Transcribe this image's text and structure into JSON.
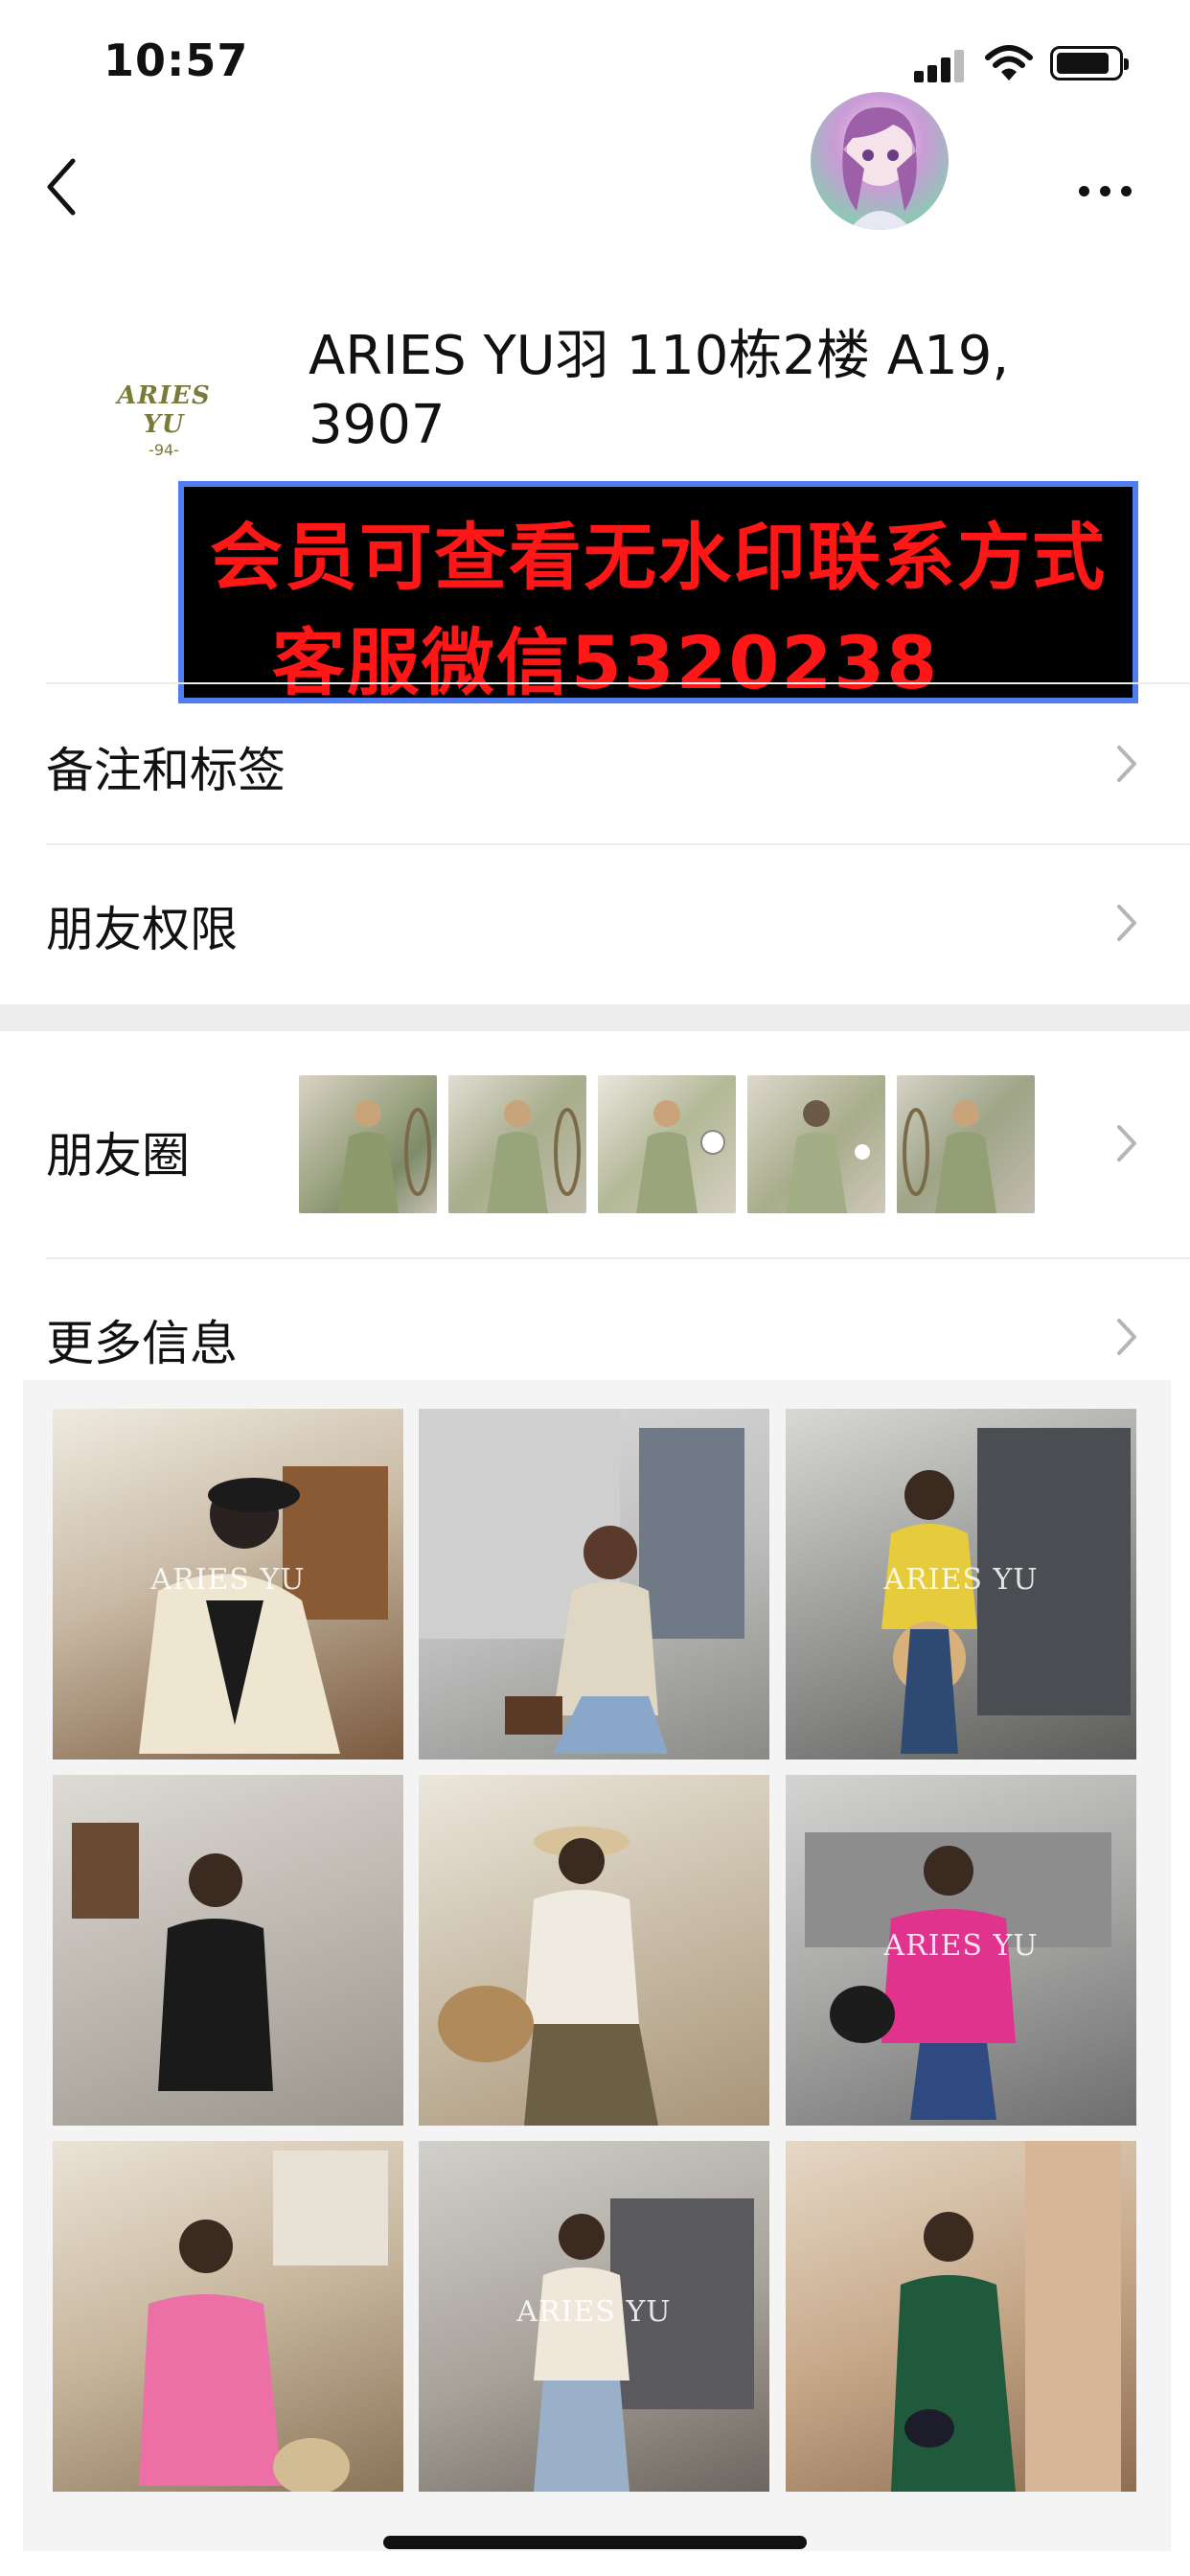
{
  "status_bar": {
    "time": "10:57"
  },
  "nav": {
    "back_icon": "chevron-left-icon",
    "more_icon": "ellipsis-icon"
  },
  "profile": {
    "logo_text": "ARIES YU",
    "logo_sub": "-94-",
    "name_line1": "ARIES YU羽 110栋2楼 A19,",
    "name_line2": "3907"
  },
  "banner": {
    "line1": "会员可查看无水印联系方式",
    "line2": "客服微信5320238",
    "text_color": "#ff1616",
    "border_color": "#4f7ef0"
  },
  "rows": {
    "remarks": "备注和标签",
    "permissions": "朋友权限",
    "moments": "朋友圈",
    "more_info": "更多信息"
  },
  "moments_thumbs": [
    "photo",
    "photo",
    "photo",
    "photo",
    "photo"
  ],
  "photos": [
    {
      "wm": "ARIES YU"
    },
    {
      "wm": ""
    },
    {
      "wm": "ARIES YU"
    },
    {
      "wm": ""
    },
    {
      "wm": ""
    },
    {
      "wm": "ARIES YU"
    },
    {
      "wm": ""
    },
    {
      "wm": "ARIES YU"
    },
    {
      "wm": ""
    }
  ]
}
